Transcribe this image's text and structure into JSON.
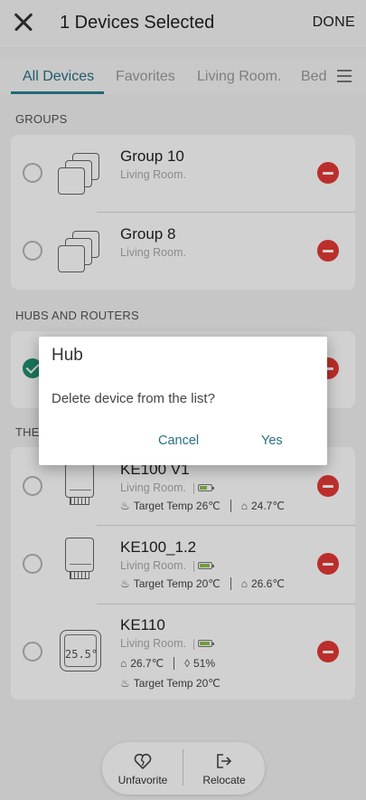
{
  "header": {
    "title": "1 Devices Selected",
    "done_label": "DONE"
  },
  "tabs": [
    {
      "label": "All Devices",
      "active": true
    },
    {
      "label": "Favorites"
    },
    {
      "label": "Living Room."
    },
    {
      "label": "Bed"
    }
  ],
  "groups": {
    "section_label": "GROUPS",
    "items": [
      {
        "name": "Group 10",
        "room": "Living Room."
      },
      {
        "name": "Group 8",
        "room": "Living Room."
      }
    ]
  },
  "hubs": {
    "section_label": "HUBS AND ROUTERS"
  },
  "thermostats": {
    "section_label": "THER",
    "items": [
      {
        "name": "KE100 V1",
        "room": "Living Room.",
        "target": "Target Temp 26℃",
        "current": "24.7℃"
      },
      {
        "name": "KE100_1.2",
        "room": "Living Room.",
        "target": "Target Temp 20℃",
        "current": "26.6℃"
      },
      {
        "name": "KE110",
        "room": "Living Room.",
        "temp": "26.7℃",
        "humidity": "51%",
        "target": "Target Temp 20℃",
        "display": "25.5°"
      }
    ]
  },
  "bottom_bar": {
    "unfavorite": "Unfavorite",
    "relocate": "Relocate"
  },
  "dialog": {
    "title": "Hub",
    "message": "Delete device from the list?",
    "cancel": "Cancel",
    "yes": "Yes"
  },
  "colors": {
    "accent": "#2a6f86",
    "remove": "#e53935",
    "selected": "#1f8f6f"
  }
}
